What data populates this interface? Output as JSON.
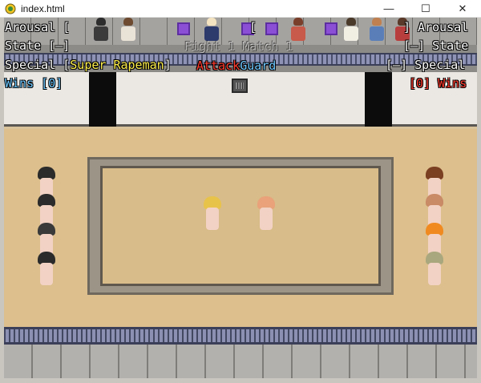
{
  "window": {
    "title": "index.html",
    "minimize_glyph": "—",
    "maximize_glyph": "☐",
    "close_glyph": "✕"
  },
  "hud": {
    "arousal_left": "Arousal [",
    "arousal_mid": "[",
    "arousal_right": "] Arousal",
    "state_left_label": "State [",
    "state_left_value": "—",
    "state_left_close": "]",
    "state_right_open": "[",
    "state_right_value": "—",
    "state_right_label": "] State",
    "match_title": "Fight 1 Match 1",
    "special_left_label": "Special [",
    "special_left_value": "Super Rapeman",
    "special_left_close": "]",
    "attack": "Attack",
    "guard": "Guard",
    "special_right_open": "[",
    "special_right_value": "—",
    "special_right_label": "] Special",
    "wins_left_label": "Wins [",
    "wins_left_value": "0",
    "wins_left_close": "]",
    "wins_right_open": "[",
    "wins_right_value": "0",
    "wins_right_label": "] Wins"
  },
  "colors": {
    "hair_blond": "#e8c34a",
    "hair_ginger": "#e9a27a",
    "hair_black": "#2b2b2b",
    "hair_brown": "#7b3f22",
    "hair_orange": "#f08a20",
    "hair_ash": "#a9a77d",
    "hair_dark_gray": "#3a3a3a",
    "hair_light_brown": "#c98a66"
  }
}
